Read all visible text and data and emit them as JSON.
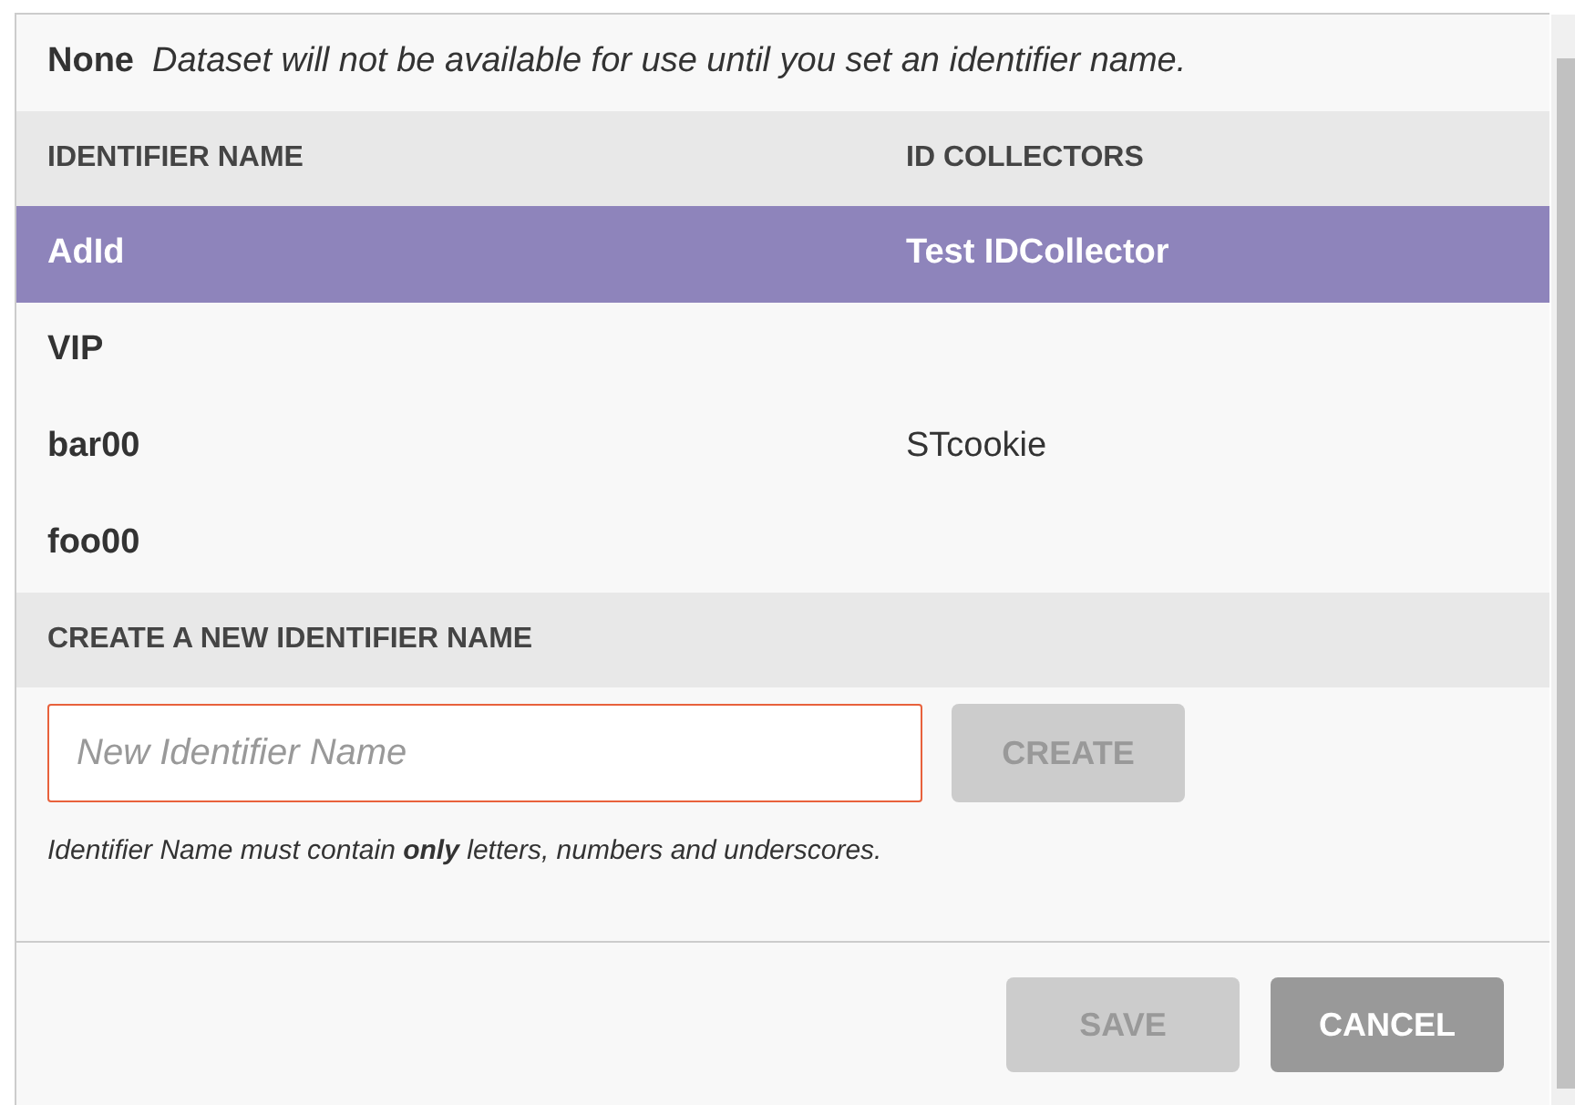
{
  "notice": {
    "label": "None",
    "message": "Dataset will not be available for use until you set an identifier name."
  },
  "table": {
    "columns": [
      "IDENTIFIER NAME",
      "ID COLLECTORS"
    ],
    "rows": [
      {
        "name": "AdId",
        "collector": "Test IDCollector",
        "selected": true
      },
      {
        "name": "VIP",
        "collector": "",
        "selected": false
      },
      {
        "name": "bar00",
        "collector": "STcookie",
        "selected": false
      },
      {
        "name": "foo00",
        "collector": "",
        "selected": false
      }
    ]
  },
  "create": {
    "title": "CREATE A NEW IDENTIFIER NAME",
    "placeholder": "New Identifier Name",
    "button": {
      "label": "CREATE",
      "disabled": true
    },
    "hint": "Identifier Name must contain **only** letters, numbers and underscores."
  },
  "buttons": [
    {
      "label": "SAVE",
      "disabled": true
    },
    {
      "label": "CANCEL",
      "disabled": false
    }
  ]
}
